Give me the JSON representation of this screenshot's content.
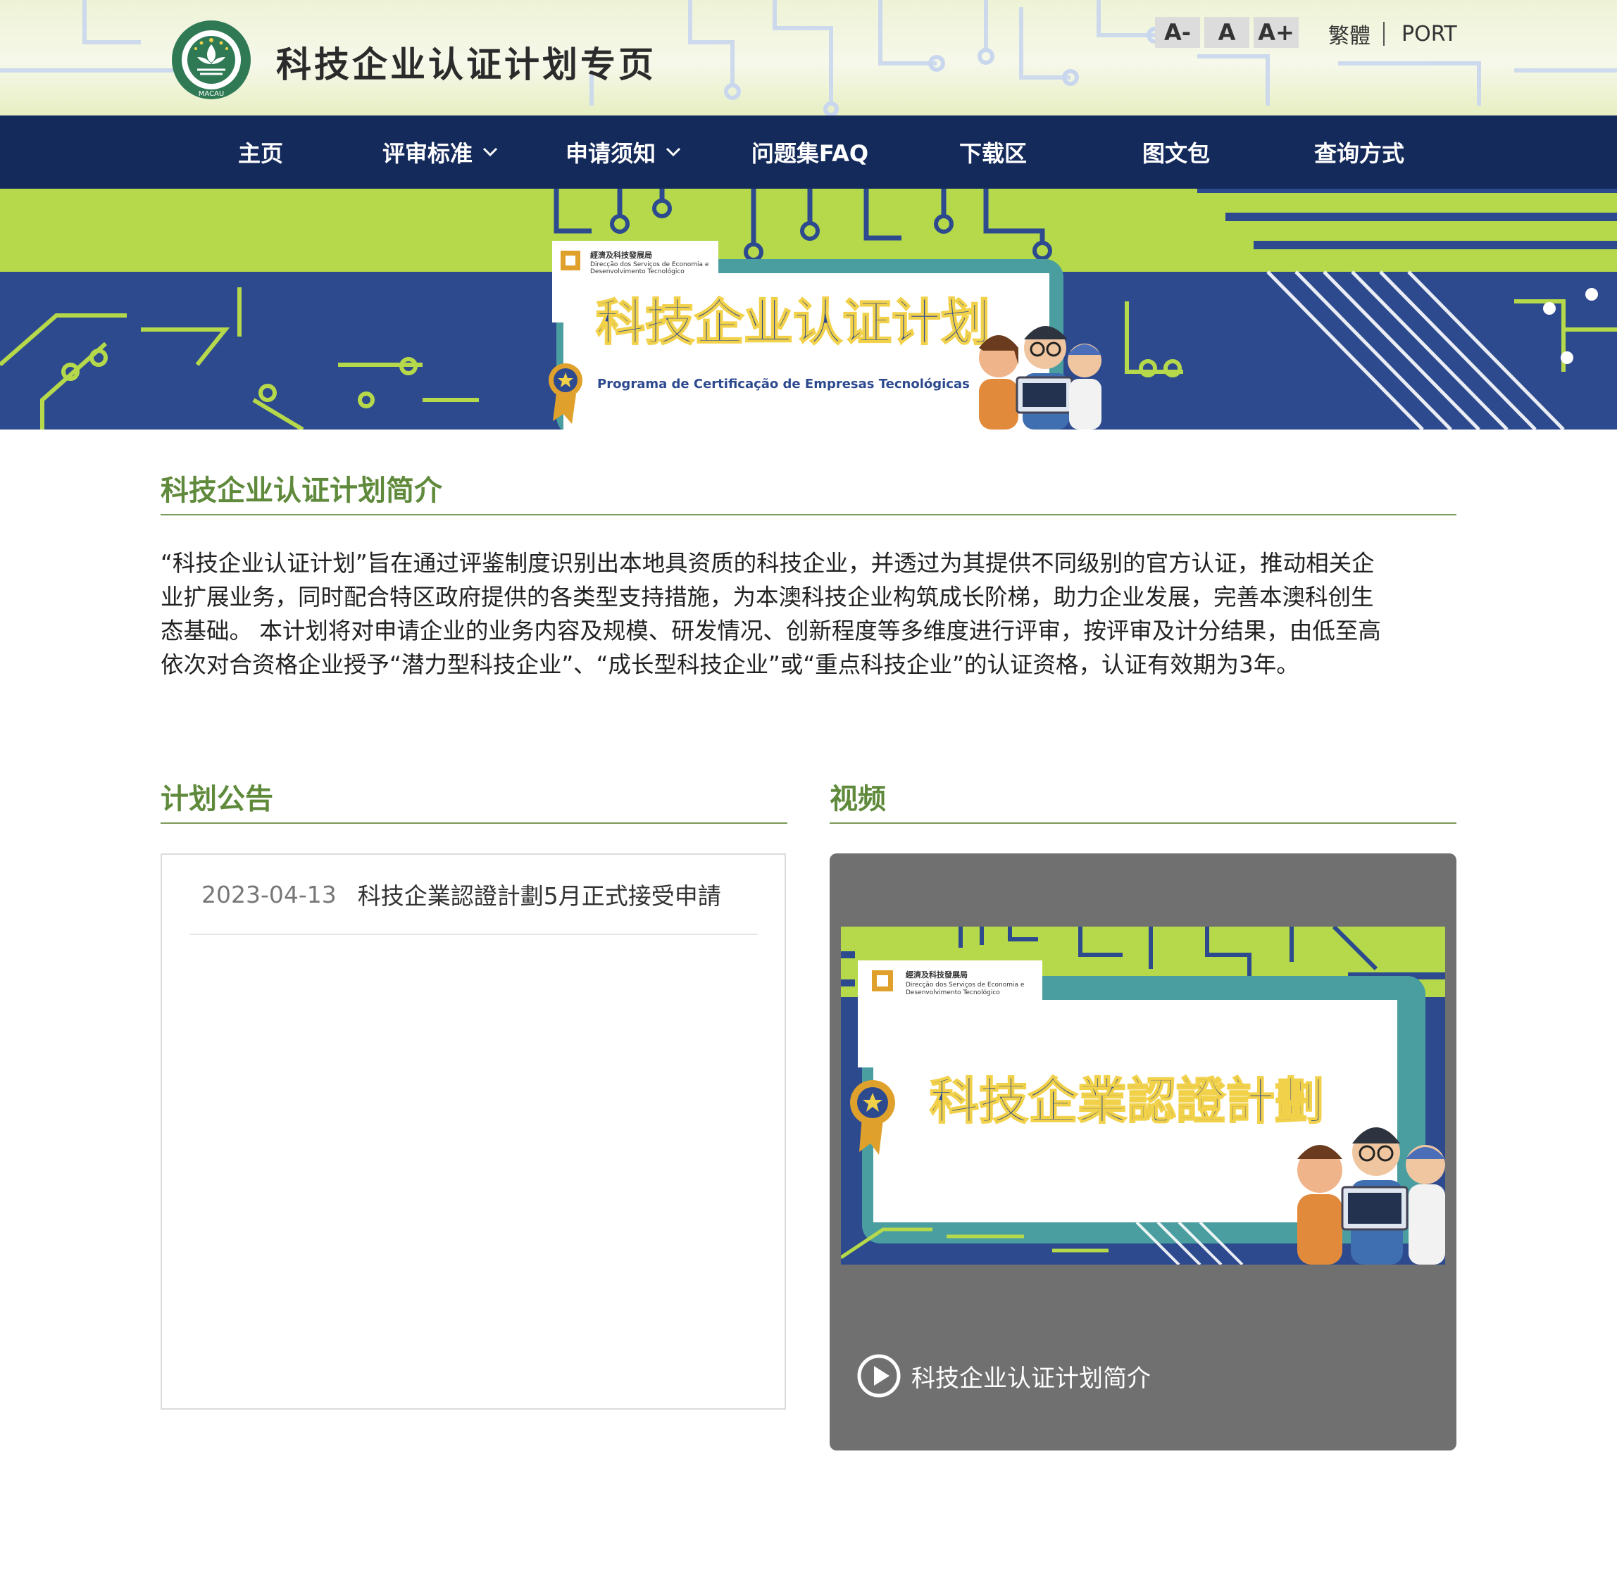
{
  "header": {
    "site_title": "科技企业认证计划专页",
    "emblem_text": "MACAU",
    "font_controls": [
      "A-",
      "A",
      "A+"
    ],
    "lang_links": [
      "繁體",
      "PORT"
    ]
  },
  "nav": {
    "items": [
      {
        "label": "主页",
        "has_dropdown": false
      },
      {
        "label": "评审标准",
        "has_dropdown": true
      },
      {
        "label": "申请须知",
        "has_dropdown": true
      },
      {
        "label": "问题集FAQ",
        "has_dropdown": false
      },
      {
        "label": "下载区",
        "has_dropdown": false
      },
      {
        "label": "图文包",
        "has_dropdown": false
      },
      {
        "label": "查询方式",
        "has_dropdown": false
      }
    ]
  },
  "banner": {
    "org_name_cn": "經濟及科技發展局",
    "org_name_pt_1": "Direcção dos Serviços de Economia e",
    "org_name_pt_2": "Desenvolvimento Tecnológico",
    "title_cn": "科技企业认证计划",
    "title_pt": "Programa de Certificação de Empresas Tecnológicas"
  },
  "intro": {
    "title": "科技企业认证计划简介",
    "lines": [
      "“科技企业认证计划”旨在通过评鉴制度识别出本地具资质的科技企业，并透过为其提供不同级别的官方认证，推动相关企",
      "业扩展业务，同时配合特区政府提供的各类型支持措施，为本澳科技企业构筑成长阶梯，助力企业发展，完善本澳科创生",
      "态基础。 本计划将对申请企业的业务内容及规模、研发情况、创新程度等多维度进行评审，按评审及计分结果，由低至高",
      "依次对合资格企业授予“潜力型科技企业”、“成长型科技企业”或“重点科技企业”的认证资格，认证有效期为3年。"
    ]
  },
  "announcements": {
    "title": "计划公告",
    "items": [
      {
        "date": "2023-04-13",
        "title": "科技企業認證計劃5月正式接受申請"
      }
    ]
  },
  "video": {
    "title": "视频",
    "thumb_org_cn": "經濟及科技發展局",
    "thumb_org_pt_1": "Direcção dos Serviços de Economia e",
    "thumb_org_pt_2": "Desenvolvimento Tecnológico",
    "thumb_title": "科技企業認證計劃",
    "caption": "科技企业认证计划简介"
  },
  "colors": {
    "nav_bg": "#142a5b",
    "accent_green": "#5f8a3b",
    "banner_blue": "#2d4a8f",
    "banner_lime": "#b5d94a"
  }
}
